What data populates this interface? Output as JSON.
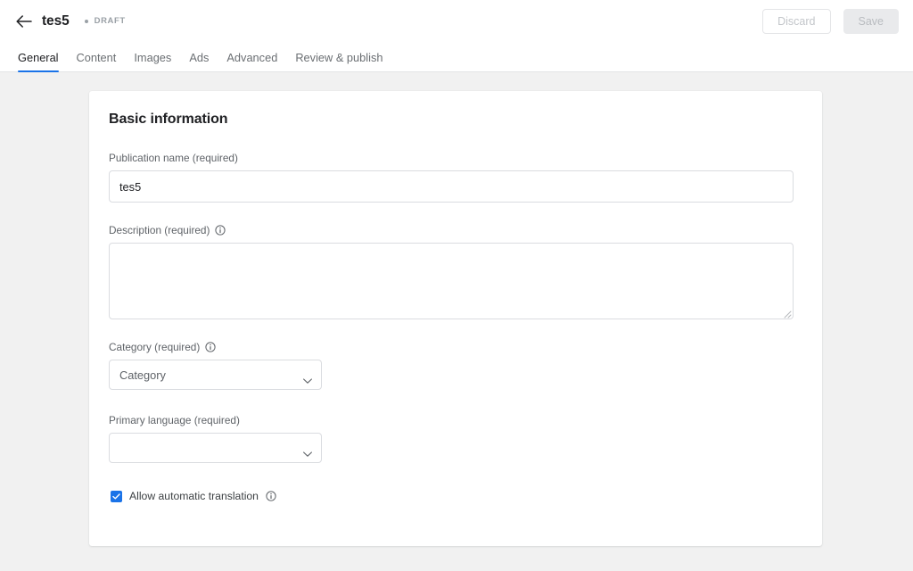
{
  "header": {
    "back_icon": "arrow-left-icon",
    "title": "tes5",
    "status_dot": "bullet-dot",
    "status": "DRAFT",
    "discard_label": "Discard",
    "save_label": "Save"
  },
  "tabs": [
    {
      "label": "General",
      "active": true
    },
    {
      "label": "Content",
      "active": false
    },
    {
      "label": "Images",
      "active": false
    },
    {
      "label": "Ads",
      "active": false
    },
    {
      "label": "Advanced",
      "active": false
    },
    {
      "label": "Review & publish",
      "active": false
    }
  ],
  "card": {
    "title": "Basic information",
    "fields": {
      "publication_name": {
        "label": "Publication name (required)",
        "value": "tes5",
        "placeholder": ""
      },
      "description": {
        "label": "Description (required)",
        "info_icon": "info-icon",
        "value": "",
        "placeholder": ""
      },
      "category": {
        "label": "Category (required)",
        "info_icon": "info-icon",
        "value": "Category",
        "arrow_icon": "chevron-down-icon"
      },
      "primary_language": {
        "label": "Primary language (required)",
        "value": "",
        "arrow_icon": "chevron-down-icon"
      },
      "allow_translation": {
        "label": "Allow automatic translation",
        "checked": true,
        "info_icon": "info-icon",
        "check_icon": "checkmark-icon"
      }
    }
  },
  "colors": {
    "accent": "#1a73e8",
    "page_bg": "#f1f1f1",
    "card_bg": "#ffffff",
    "border": "#dadce0",
    "label_text": "#5f6368",
    "title_text": "#202124"
  }
}
